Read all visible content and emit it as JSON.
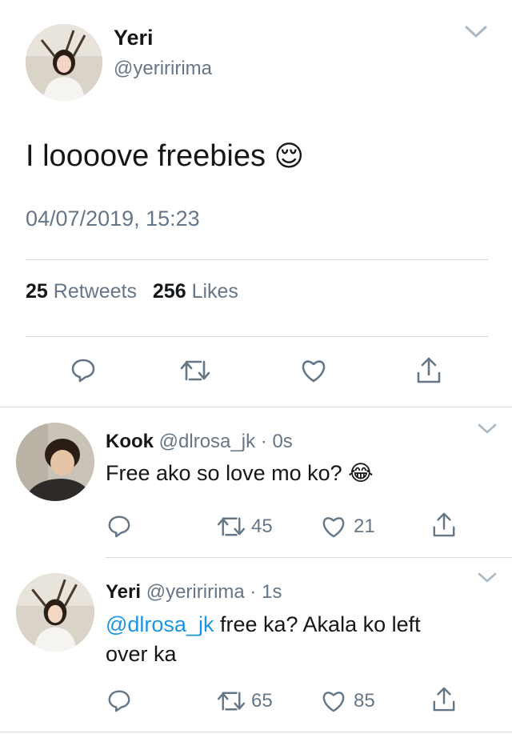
{
  "main_tweet": {
    "display_name": "Yeri",
    "handle": "@yeriririma",
    "text": "I loooove freebies",
    "emoji": "😌",
    "timestamp": "04/07/2019, 15:23",
    "retweets_count": "25",
    "retweets_label": "Retweets",
    "likes_count": "256",
    "likes_label": "Likes"
  },
  "replies": [
    {
      "display_name": "Kook",
      "handle": "@dlrosa_jk",
      "separator": "·",
      "time": "0s",
      "text": "Free ako so love mo ko?",
      "emoji": "😂",
      "retweets": "45",
      "likes": "21"
    },
    {
      "display_name": "Yeri",
      "handle": "@yeriririma",
      "separator": "·",
      "time": "1s",
      "mention": "@dlrosa_jk",
      "text_line1": " free ka? Akala ko left",
      "text_line2": "over ka",
      "retweets": "65",
      "likes": "85"
    }
  ],
  "icons": [
    "reply-icon",
    "retweet-icon",
    "like-icon",
    "share-icon",
    "chevron-down-icon"
  ],
  "colors": {
    "mention": "#1b95e0",
    "secondary_text": "#657786",
    "divider": "#d7dadd"
  }
}
